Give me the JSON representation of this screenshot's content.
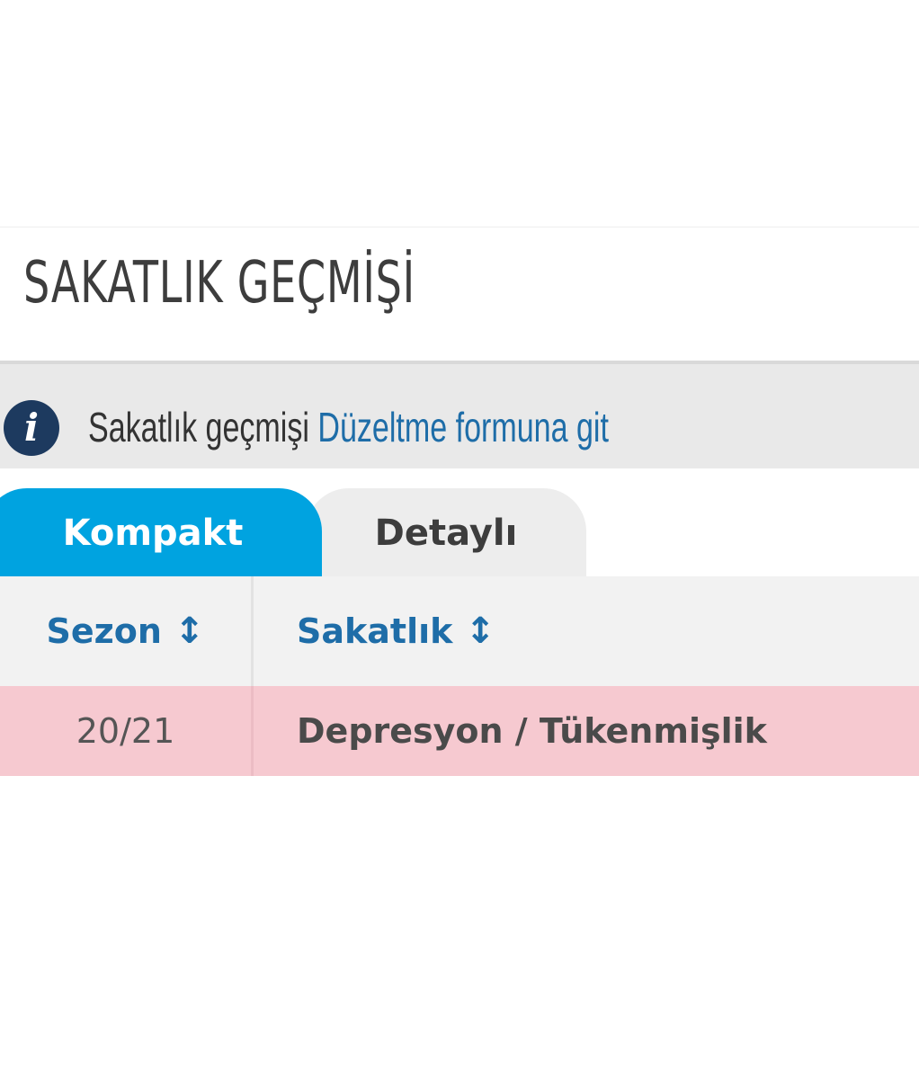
{
  "section": {
    "title": "SAKATLIK GEÇMİŞİ"
  },
  "info_bar": {
    "icon": "info-icon",
    "icon_glyph": "i",
    "label": "Sakatlık geçmişi",
    "link_text": "Düzeltme formuna git"
  },
  "tabs": [
    {
      "label": "Kompakt",
      "active": true
    },
    {
      "label": "Detaylı",
      "active": false
    }
  ],
  "table": {
    "columns": [
      {
        "label": "Sezon",
        "sort_icon": "↕"
      },
      {
        "label": "Sakatlık",
        "sort_icon": "↕"
      }
    ],
    "rows": [
      {
        "season": "20/21",
        "injury": "Depresyon / Tükenmişlik"
      }
    ]
  },
  "colors": {
    "tab_active": "#00a3e0",
    "tab_inactive": "#ededed",
    "link": "#1e6da8",
    "row_highlight": "#f6c9d0",
    "info_bar": "#e9e9e9",
    "info_icon": "#1d3a5f"
  }
}
